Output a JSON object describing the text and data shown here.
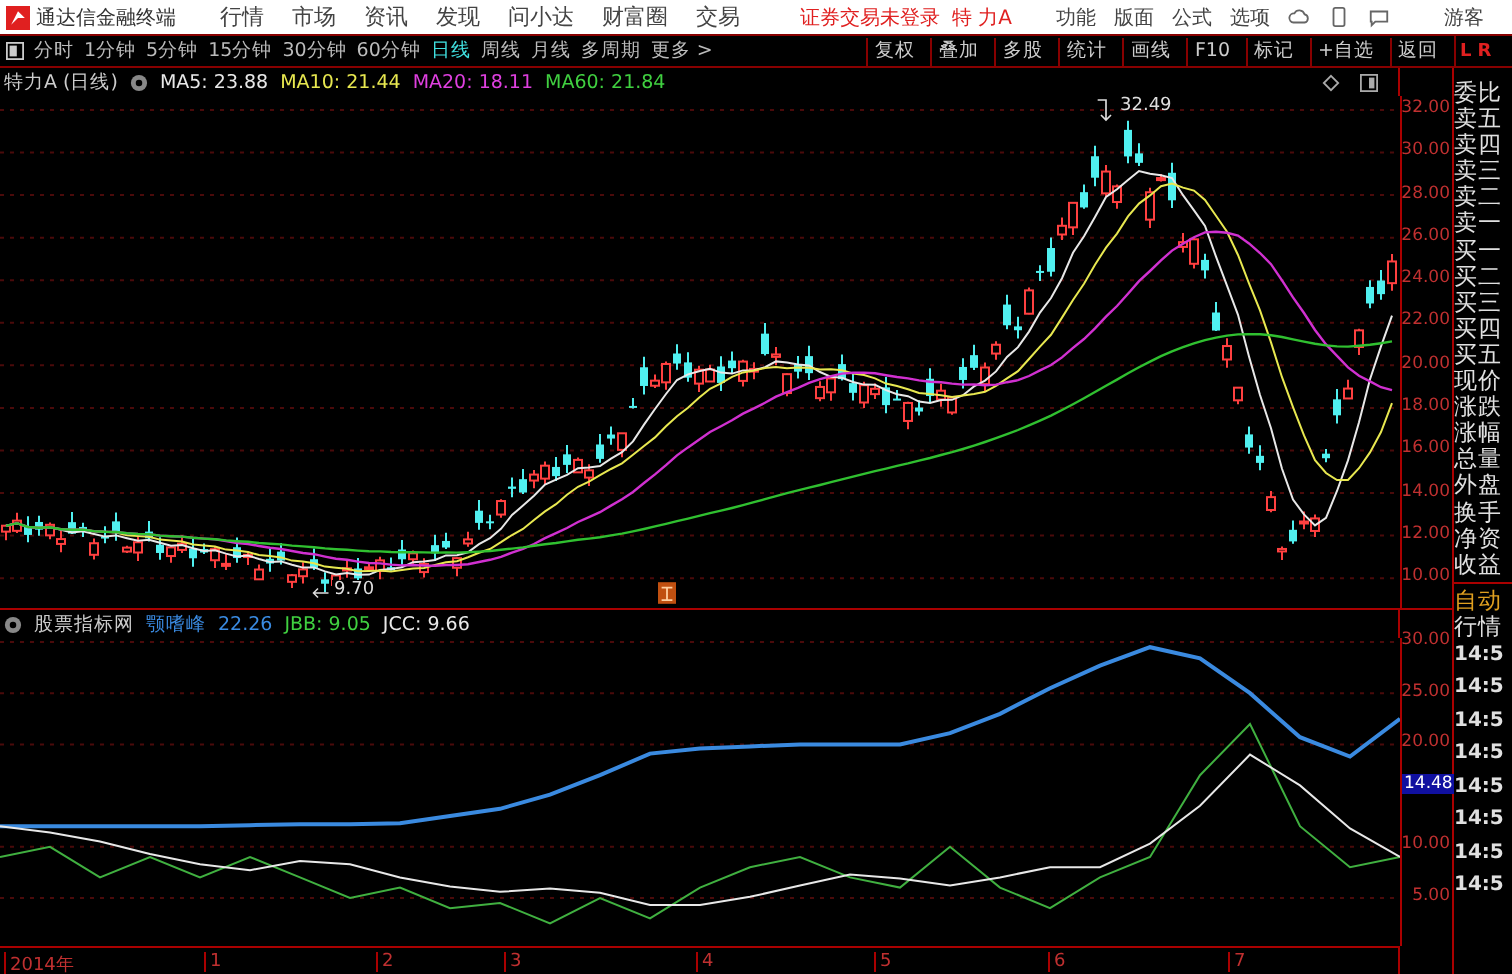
{
  "app": {
    "title": "通达信金融终端"
  },
  "menu": [
    "行情",
    "市场",
    "资讯",
    "发现",
    "问小达",
    "财富圈",
    "交易"
  ],
  "login_status": "证券交易未登录",
  "stock_title": "特 力A",
  "top_actions": [
    "功能",
    "版面",
    "公式",
    "选项"
  ],
  "user": "游客",
  "periods": [
    {
      "label": "分时",
      "selected": false
    },
    {
      "label": "1分钟",
      "selected": false
    },
    {
      "label": "5分钟",
      "selected": false
    },
    {
      "label": "15分钟",
      "selected": false
    },
    {
      "label": "30分钟",
      "selected": false
    },
    {
      "label": "60分钟",
      "selected": false
    },
    {
      "label": "日线",
      "selected": true
    },
    {
      "label": "周线",
      "selected": false
    },
    {
      "label": "月线",
      "selected": false
    },
    {
      "label": "多周期",
      "selected": false
    },
    {
      "label": "更多 >",
      "selected": false
    }
  ],
  "tools": [
    "复权",
    "叠加",
    "多股",
    "统计",
    "画线",
    "F10",
    "标记",
    "+自选",
    "返回"
  ],
  "corner": [
    "L",
    "R"
  ],
  "legend": {
    "title": "特力A (日线)",
    "items": [
      {
        "text": "MA5: 23.88",
        "color": "#e8e8e8"
      },
      {
        "text": "MA10: 21.44",
        "color": "#e8e850"
      },
      {
        "text": "MA20: 18.11",
        "color": "#e040e0"
      },
      {
        "text": "MA60: 21.84",
        "color": "#40d040"
      }
    ]
  },
  "price_high": "32.49",
  "price_low": "9.70",
  "price_axis": [
    "32.00",
    "30.00",
    "28.00",
    "26.00",
    "24.00",
    "22.00",
    "20.00",
    "18.00",
    "16.00",
    "14.00",
    "12.00",
    "10.00"
  ],
  "indicator": {
    "name": "股票指标网",
    "items": [
      {
        "text": "颚嗜峰",
        "color": "#3a8ae0"
      },
      {
        "text": "22.26",
        "color": "#3a8ae0"
      },
      {
        "text": "JBB: 9.05",
        "color": "#40d040"
      },
      {
        "text": "JCC: 9.66",
        "color": "#e8e8e8"
      }
    ],
    "chart_data": {
      "type": "line",
      "ylim": [
        0.3,
        30.4
      ],
      "grid": true,
      "yticks": [
        {
          "value": 30,
          "label": "30.00"
        },
        {
          "value": 25,
          "label": "25.00"
        },
        {
          "value": 20,
          "label": "20.00"
        },
        {
          "value": 10,
          "label": "10.00"
        },
        {
          "value": 5,
          "label": "5.00"
        }
      ],
      "series": [
        {
          "color": "#3a8ae0",
          "values": [
            12,
            12,
            12,
            12,
            12,
            12.1,
            12.2,
            12.2,
            12.3,
            13,
            13.7,
            15.1,
            17,
            19.1,
            19.6,
            19.8,
            20,
            20,
            20,
            21.1,
            23,
            25.5,
            27.7,
            29.5,
            28.4,
            25,
            20.7,
            18.8,
            22.5
          ]
        },
        {
          "color": "#40b040",
          "values": [
            9,
            10,
            7,
            9,
            7,
            9,
            7,
            5,
            6,
            4,
            4.5,
            2.5,
            5,
            3,
            6,
            8,
            9,
            7,
            6,
            10,
            6,
            4,
            7,
            9,
            17,
            22,
            12,
            8,
            9
          ]
        },
        {
          "color": "#e8e8e8",
          "values": [
            12,
            11.4,
            10.5,
            9.3,
            8.3,
            7.7,
            8.6,
            8.3,
            7,
            6.1,
            5.6,
            5.9,
            5.5,
            4.3,
            4.3,
            5.1,
            6.2,
            7.3,
            6.9,
            6.2,
            7,
            8,
            8,
            10.3,
            14,
            19,
            16,
            11.8,
            9
          ]
        }
      ]
    }
  },
  "cursor_value": "14.48",
  "time_axis": [
    "2014年",
    "1",
    "2",
    "3",
    "4",
    "5",
    "6",
    "7"
  ],
  "quote_fields": [
    "委比",
    "卖五",
    "卖四",
    "卖三",
    "卖二",
    "卖一",
    "买一",
    "买二",
    "买三",
    "买四",
    "买五",
    "现价",
    "涨跌",
    "涨幅",
    "总量",
    "外盘",
    "换手",
    "净资",
    "收益"
  ],
  "quote_status": [
    "自动",
    "行情"
  ],
  "quote_times": [
    "14:5",
    "14:5",
    "14:5",
    "14:5",
    "14:5",
    "14:5",
    "14:5",
    "14:5"
  ]
}
